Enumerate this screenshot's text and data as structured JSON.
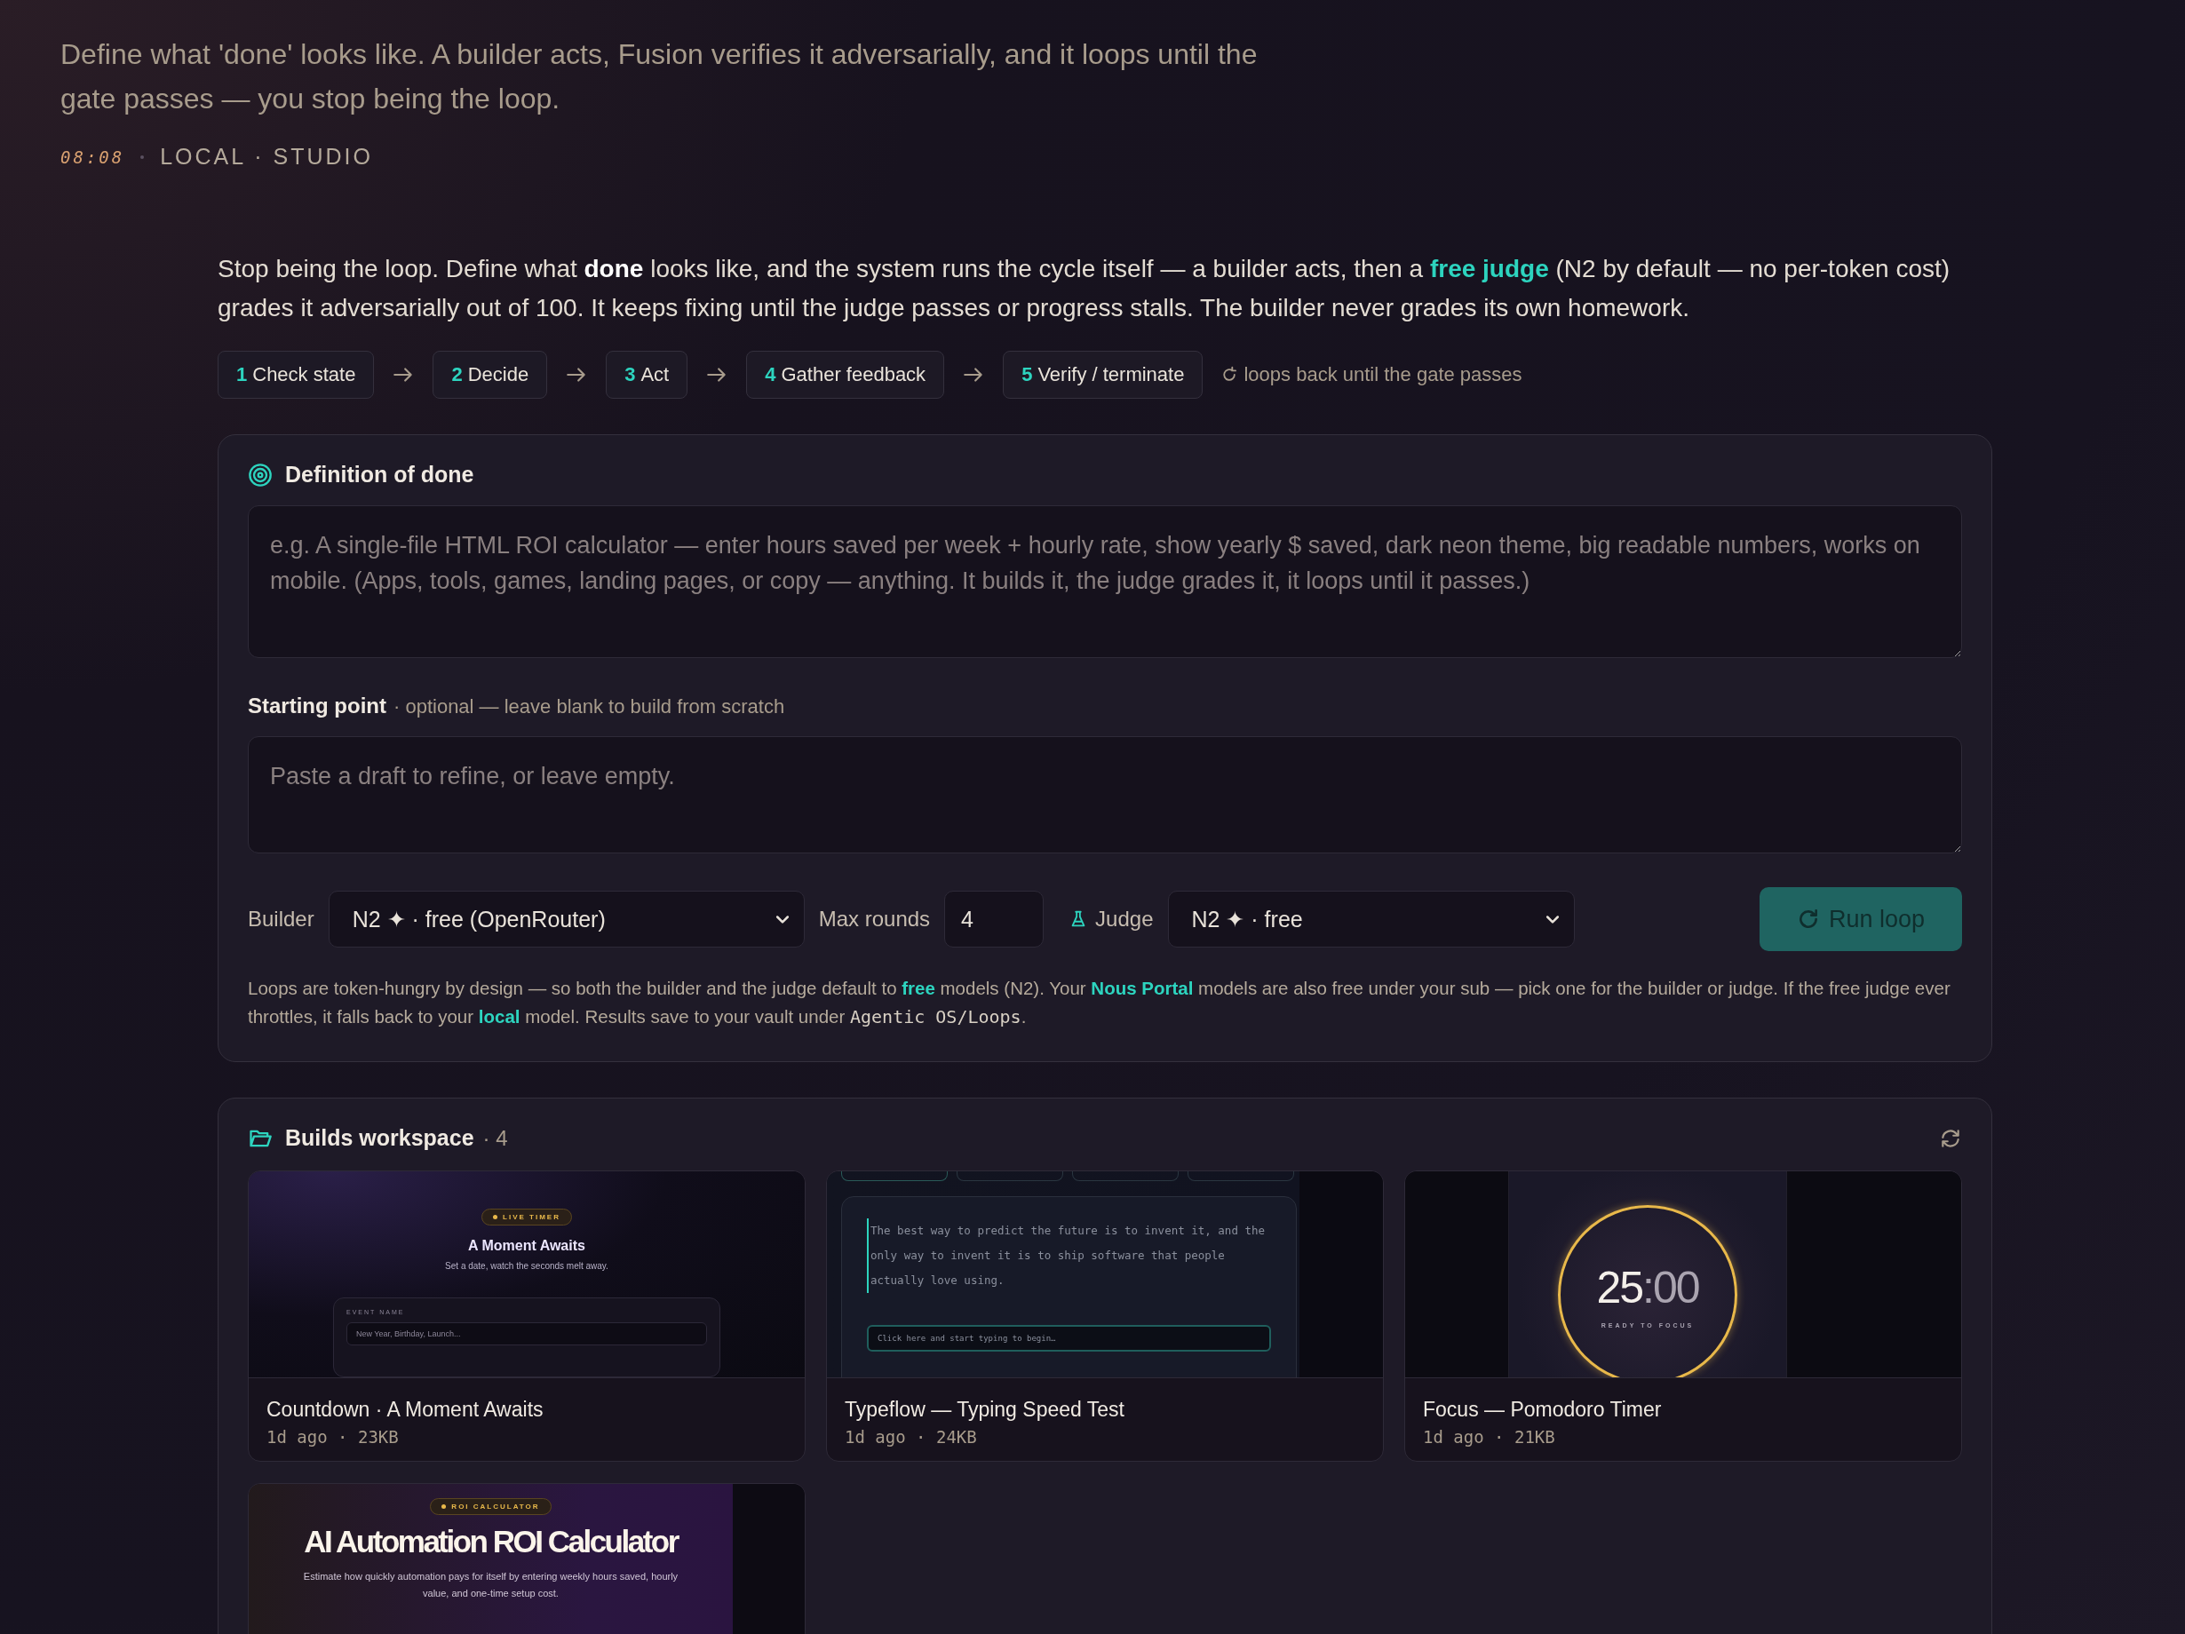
{
  "header": {
    "subtitle": "Define what 'done' looks like. A builder acts, Fusion verifies it adversarially, and it loops until the gate passes — you stop being the loop.",
    "time": "08:08",
    "location": "LOCAL · STUDIO"
  },
  "intro": "Stop being the loop. Define what **done** looks like, and the system runs the cycle itself — a builder acts, then a **free judge** (N2 by default — no per-token cost) grades it adversarially out of 100. It keeps fixing until the judge passes or progress stalls. The builder never grades its own homework.",
  "steps": [
    {
      "number": "1",
      "label": "Check state"
    },
    {
      "number": "2",
      "label": "Decide"
    },
    {
      "number": "3",
      "label": "Act"
    },
    {
      "number": "4",
      "label": "Gather feedback"
    },
    {
      "number": "5",
      "label": "Verify / terminate"
    }
  ],
  "loop_note": "loops back until the gate passes",
  "definition": {
    "title": "Definition of done",
    "placeholder": "e.g. A single-file HTML ROI calculator — enter hours saved per week + hourly rate, show yearly $ saved, dark neon theme, big readable numbers, works on mobile. (Apps, tools, games, landing pages, or copy — anything. It builds it, the judge grades it, it loops until it passes.)"
  },
  "starting_point": {
    "label": "Starting point",
    "hint": "· optional — leave blank to build from scratch",
    "placeholder": "Paste a draft to refine, or leave empty."
  },
  "controls": {
    "builder_label": "Builder",
    "builder_value": "N2 ✦ · free (OpenRouter)",
    "max_rounds_label": "Max rounds",
    "max_rounds": "4",
    "judge_label": "Judge",
    "judge_value": "N2 ✦ · free",
    "run_button": "Run loop"
  },
  "note": {
    "text": "Loops are token-hungry by design — so both the builder and the judge default to **free** models (N2). Your **Nous Portal** models are also free under your sub — pick one for the builder or judge. If the free judge ever throttles, it falls back to your **local** model. Results save to your vault under",
    "path": "Agentic OS/Loops",
    "end": "."
  },
  "builds": {
    "title": "Builds workspace",
    "count": "· 4",
    "items": [
      {
        "title": "Countdown · A Moment Awaits",
        "meta": "1d ago · 23KB",
        "thumbnail": {
          "kind": "countdown",
          "badge": "LIVE TIMER",
          "heading": "A Moment Awaits",
          "tagline": "Set a date, watch the seconds melt away.",
          "field_label": "EVENT NAME",
          "field_placeholder": "New Year, Birthday, Launch..."
        }
      },
      {
        "title": "Typeflow — Typing Speed Test",
        "meta": "1d ago · 24KB",
        "thumbnail": {
          "kind": "typing",
          "passage": "The best way to predict the future is to invent it, and the only way to invent it is to ship software that people actually love using.",
          "field_placeholder": "Click here and start typing to begin…"
        }
      },
      {
        "title": "Focus — Pomodoro Timer",
        "meta": "1d ago · 21KB",
        "thumbnail": {
          "kind": "pomodoro",
          "minutes": "25",
          "separator": ":",
          "seconds": "00",
          "status": "READY TO FOCUS"
        }
      },
      {
        "thumbnail": {
          "kind": "roi",
          "badge": "ROI CALCULATOR",
          "heading": "AI Automation ROI Calculator",
          "description": "Estimate how quickly automation pays for itself by entering weekly hours saved, hourly value, and one-time setup cost."
        }
      }
    ]
  }
}
